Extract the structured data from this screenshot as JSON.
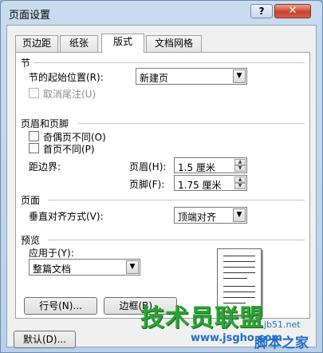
{
  "window": {
    "title": "页面设置",
    "help_label": "?",
    "close_label": "✕"
  },
  "tabs": [
    {
      "label": "页边距",
      "active": false
    },
    {
      "label": "纸张",
      "active": false
    },
    {
      "label": "版式",
      "active": true
    },
    {
      "label": "文档网格",
      "active": false
    }
  ],
  "section": {
    "heading": "节",
    "start_label": "节的起始位置(R):",
    "start_value": "新建页",
    "suppress_endnotes_label": "取消尾注(U)"
  },
  "headers_footers": {
    "heading": "页眉和页脚",
    "odd_even_label": "奇偶页不同(O)",
    "first_page_label": "首页不同(P)",
    "from_edge_label": "距边界:",
    "header_label": "页眉(H):",
    "header_value": "1.5 厘米",
    "footer_label": "页脚(F):",
    "footer_value": "1.75 厘米"
  },
  "page": {
    "heading": "页面",
    "valign_label": "垂直对齐方式(V):",
    "valign_value": "顶端对齐"
  },
  "preview": {
    "heading": "预览",
    "apply_label": "应用于(Y):",
    "apply_value": "整篇文档"
  },
  "buttons": {
    "line_numbers": "行号(N)...",
    "borders": "边框(B)...",
    "default": "默认(D)..."
  },
  "watermark": {
    "main": "技术员联盟",
    "url": "www.jsgho.com",
    "domain": "jb51.net",
    "small": "脚本之家"
  }
}
